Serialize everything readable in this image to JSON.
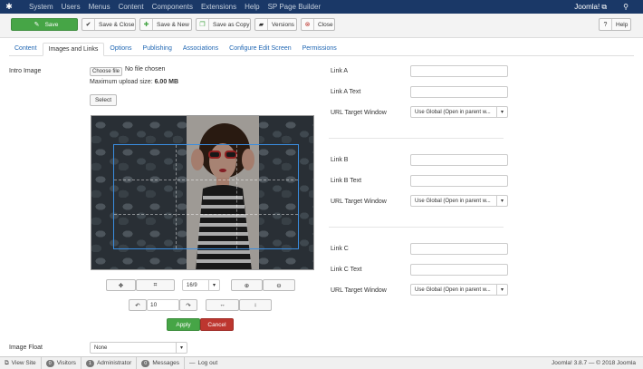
{
  "topnav": {
    "menu": [
      "System",
      "Users",
      "Menus",
      "Content",
      "Components",
      "Extensions",
      "Help",
      "SP Page Builder"
    ],
    "site_link": "Joomla! ⧉",
    "user_icon": "user-icon"
  },
  "toolbar": {
    "save": "Save",
    "save_close": "Save & Close",
    "save_new": "Save & New",
    "save_copy": "Save as Copy",
    "versions": "Versions",
    "close": "Close",
    "help": "Help"
  },
  "tabs": [
    "Content",
    "Images and Links",
    "Options",
    "Publishing",
    "Associations",
    "Configure Edit Screen",
    "Permissions"
  ],
  "intro_image": {
    "label": "Intro Image",
    "choose_file": "Choose file",
    "no_file": "No file chosen",
    "max_upload_label": "Maximum upload size: ",
    "max_upload_value": "6.00 MB",
    "select": "Select"
  },
  "crop_controls": {
    "ratio": "16/9",
    "rotate_value": "10",
    "apply": "Apply",
    "cancel": "Cancel"
  },
  "image_float": {
    "label": "Image Float",
    "value": "None"
  },
  "links": [
    {
      "link_label": "Link A",
      "text_label": "Link A Text",
      "target_label": "URL Target Window",
      "target_value": "Use Global (Open in parent w..."
    },
    {
      "link_label": "Link B",
      "text_label": "Link B Text",
      "target_label": "URL Target Window",
      "target_value": "Use Global (Open in parent w..."
    },
    {
      "link_label": "Link C",
      "text_label": "Link C Text",
      "target_label": "URL Target Window",
      "target_value": "Use Global (Open in parent w..."
    }
  ],
  "statusbar": {
    "view_site": "View Site",
    "visitors_count": "0",
    "visitors": "Visitors",
    "admin_count": "1",
    "administrator": "Administrator",
    "messages_count": "0",
    "messages": "Messages",
    "logout": "Log out",
    "version": "Joomla! 3.8.7  —  © 2018 Joomla"
  },
  "colors": {
    "nav": "#1a3867",
    "save": "#46a546",
    "apply": "#46a546",
    "cancel": "#bd362f",
    "link": "#1f66b3"
  }
}
